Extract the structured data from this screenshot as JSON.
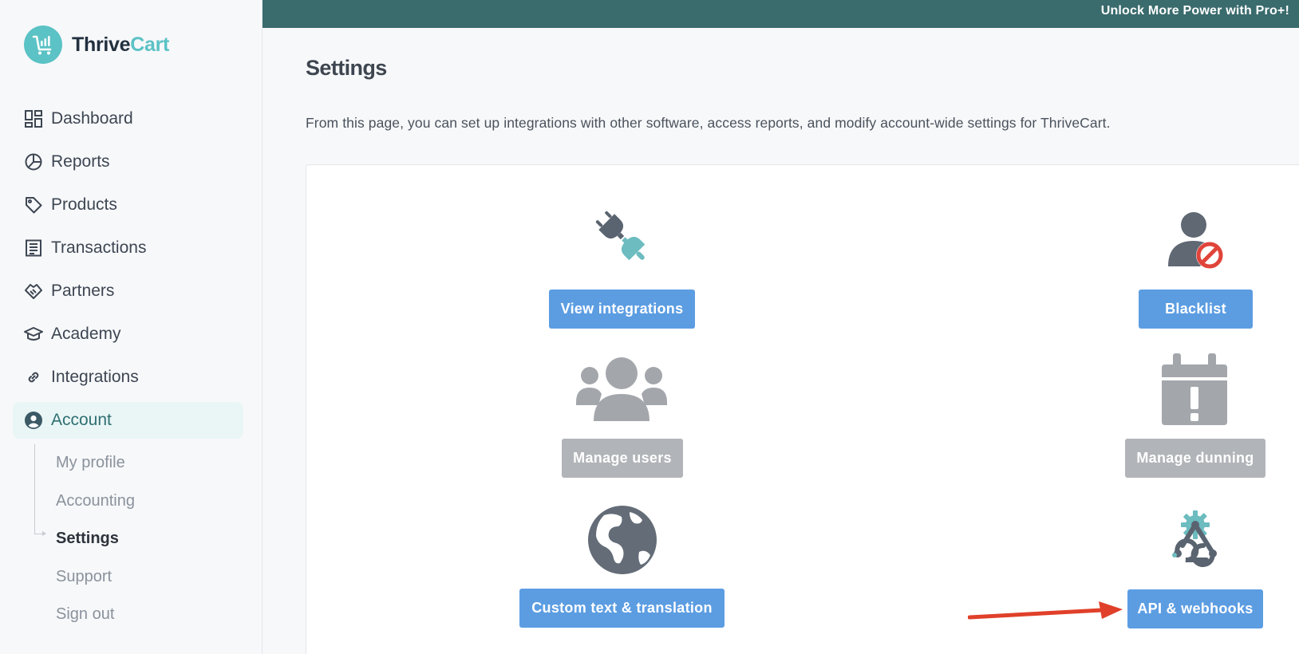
{
  "banner": {
    "text": "Unlock More Power with Pro+!"
  },
  "brand": {
    "part1": "Thrive",
    "part2": "Cart",
    "accent_color": "#5bc2c5"
  },
  "sidebar": {
    "items": [
      {
        "label": "Dashboard",
        "icon": "dashboard-icon"
      },
      {
        "label": "Reports",
        "icon": "pie-chart-icon"
      },
      {
        "label": "Products",
        "icon": "tag-icon"
      },
      {
        "label": "Transactions",
        "icon": "receipt-icon"
      },
      {
        "label": "Partners",
        "icon": "handshake-icon"
      },
      {
        "label": "Academy",
        "icon": "graduation-cap-icon"
      },
      {
        "label": "Integrations",
        "icon": "link-icon"
      },
      {
        "label": "Account",
        "icon": "user-circle-icon",
        "active": true
      }
    ],
    "account_sub": [
      {
        "label": "My profile"
      },
      {
        "label": "Accounting"
      },
      {
        "label": "Settings",
        "active": true
      },
      {
        "label": "Support"
      },
      {
        "label": "Sign out"
      }
    ]
  },
  "main": {
    "title": "Settings",
    "description": "From this page, you can set up integrations with other software, access reports, and modify account-wide settings for ThriveCart.",
    "tiles": [
      {
        "label": "View integrations",
        "icon": "plug-icon",
        "style": "blue"
      },
      {
        "label": "Blacklist",
        "icon": "user-blocked-icon",
        "style": "blue"
      },
      {
        "label": "Manage users",
        "icon": "users-group-icon",
        "style": "gray"
      },
      {
        "label": "Manage dunning",
        "icon": "calendar-alert-icon",
        "style": "gray"
      },
      {
        "label": "Custom text & translation",
        "icon": "globe-icon",
        "style": "blue"
      },
      {
        "label": "API & webhooks",
        "icon": "webhook-icon",
        "style": "blue"
      }
    ]
  },
  "colors": {
    "banner": "#3a6b6d",
    "button_blue": "#5c9de2",
    "button_gray": "#b1b4b8",
    "annotation_arrow": "#e0402a"
  }
}
